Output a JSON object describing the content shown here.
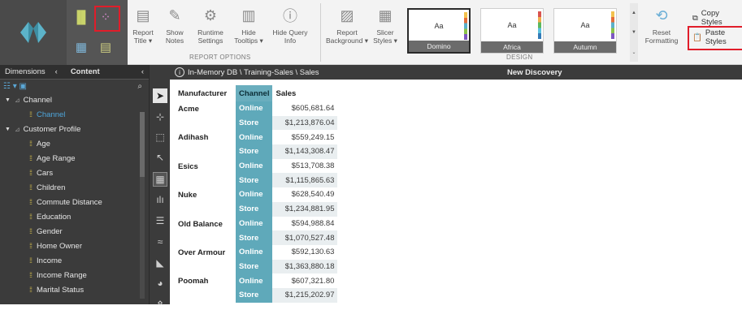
{
  "ribbon": {
    "buttons": {
      "report_title": "Report\nTitle ▾",
      "show_notes": "Show\nNotes",
      "runtime_settings": "Runtime\nSettings",
      "hide_tooltips": "Hide\nTooltips ▾",
      "hide_query_info": "Hide Query\nInfo",
      "report_background": "Report\nBackground ▾",
      "slicer_styles": "Slicer\nStyles ▾",
      "reset_formatting": "Reset\nFormatting"
    },
    "groups": {
      "report_options": "REPORT OPTIONS",
      "design": "DESIGN"
    },
    "themes": [
      {
        "aa": "Aa",
        "name": "Domino"
      },
      {
        "aa": "Aa",
        "name": "Africa"
      },
      {
        "aa": "Aa",
        "name": "Autumn"
      }
    ],
    "copy_styles": "Copy Styles",
    "paste_styles": "Paste Styles",
    "accent_red": "#e11d2a"
  },
  "left_panel": {
    "tab_dimensions": "Dimensions",
    "tab_content": "Content",
    "tree": [
      {
        "label": "Channel",
        "type": "folder"
      },
      {
        "label": "Channel",
        "type": "field",
        "active": true
      },
      {
        "label": "Customer Profile",
        "type": "folder"
      },
      {
        "label": "Age",
        "type": "field"
      },
      {
        "label": "Age Range",
        "type": "field"
      },
      {
        "label": "Cars",
        "type": "field"
      },
      {
        "label": "Children",
        "type": "field"
      },
      {
        "label": "Commute Distance",
        "type": "field"
      },
      {
        "label": "Education",
        "type": "field"
      },
      {
        "label": "Gender",
        "type": "field"
      },
      {
        "label": "Home Owner",
        "type": "field"
      },
      {
        "label": "Income",
        "type": "field"
      },
      {
        "label": "Income Range",
        "type": "field"
      },
      {
        "label": "Marital Status",
        "type": "field"
      }
    ]
  },
  "pathbar": {
    "path": "In-Memory DB \\ Training-Sales \\ Sales",
    "discovery": "New Discovery"
  },
  "table": {
    "headers": [
      "Manufacturer",
      "Channel",
      "Sales"
    ],
    "rows": [
      {
        "mf": "Acme",
        "ch": "Online",
        "sales": "$605,681.64"
      },
      {
        "mf": "",
        "ch": "Store",
        "sales": "$1,213,876.04"
      },
      {
        "mf": "Adihash",
        "ch": "Online",
        "sales": "$559,249.15"
      },
      {
        "mf": "",
        "ch": "Store",
        "sales": "$1,143,308.47"
      },
      {
        "mf": "Esics",
        "ch": "Online",
        "sales": "$513,708.38"
      },
      {
        "mf": "",
        "ch": "Store",
        "sales": "$1,115,865.63"
      },
      {
        "mf": "Nuke",
        "ch": "Online",
        "sales": "$628,540.49"
      },
      {
        "mf": "",
        "ch": "Store",
        "sales": "$1,234,881.95"
      },
      {
        "mf": "Old Balance",
        "ch": "Online",
        "sales": "$594,988.84"
      },
      {
        "mf": "",
        "ch": "Store",
        "sales": "$1,070,527.48"
      },
      {
        "mf": "Over Armour",
        "ch": "Online",
        "sales": "$592,130.63"
      },
      {
        "mf": "",
        "ch": "Store",
        "sales": "$1,363,880.18"
      },
      {
        "mf": "Poomah",
        "ch": "Online",
        "sales": "$607,321.80"
      },
      {
        "mf": "",
        "ch": "Store",
        "sales": "$1,215,202.97"
      }
    ]
  }
}
